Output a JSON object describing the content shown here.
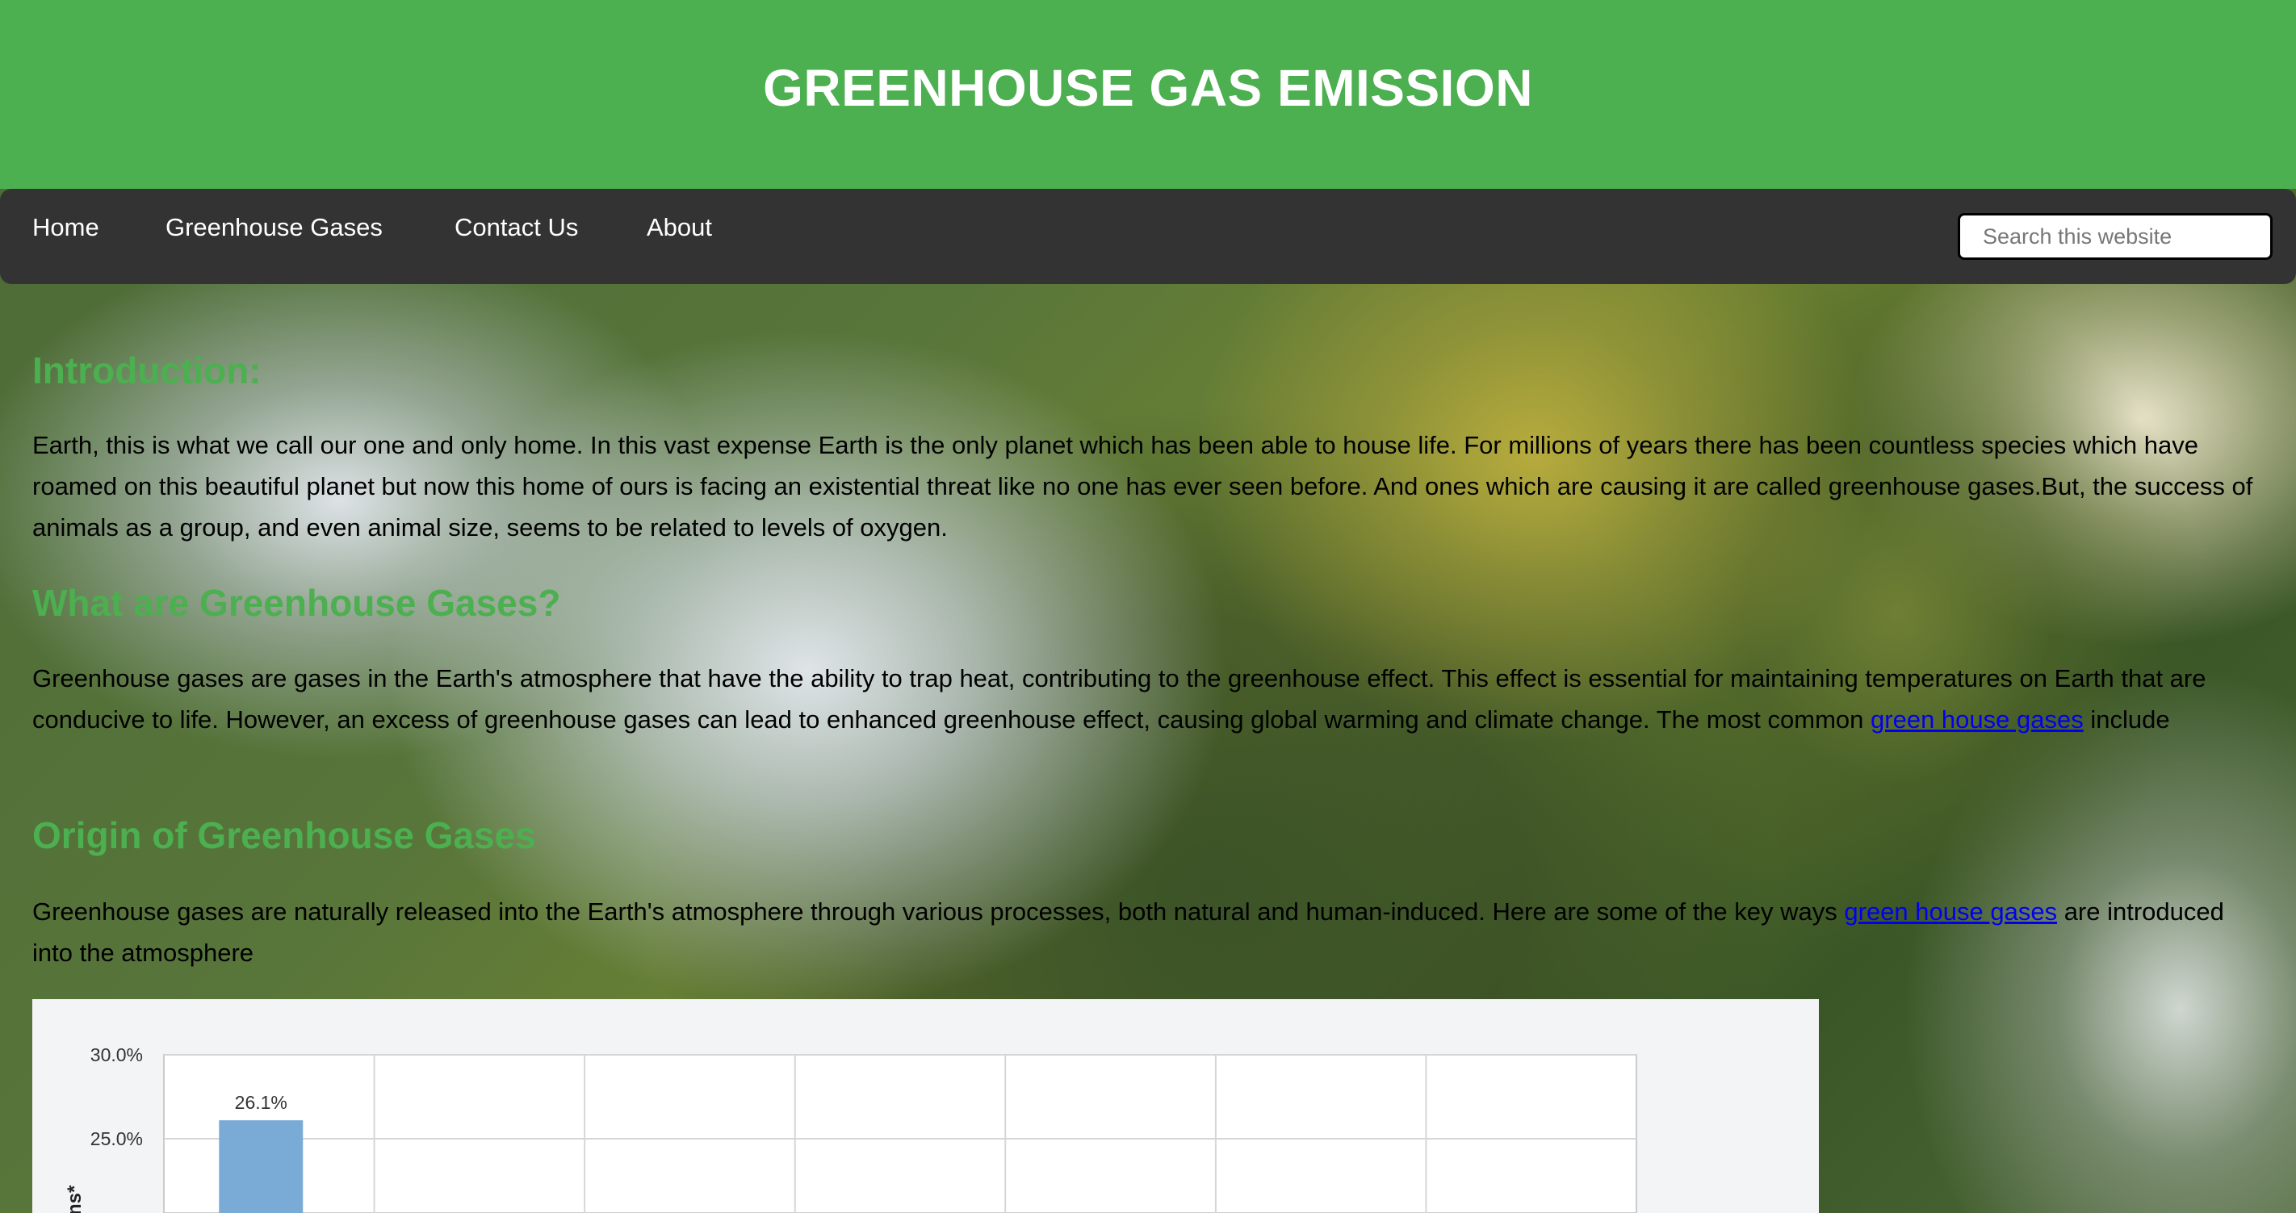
{
  "header": {
    "title": "GREENHOUSE GAS EMISSION"
  },
  "nav": {
    "items": [
      {
        "label": "Home"
      },
      {
        "label": "Greenhouse Gases"
      },
      {
        "label": "Contact Us"
      },
      {
        "label": "About"
      }
    ],
    "search_placeholder": "Search this website"
  },
  "sections": [
    {
      "title": "Introduction:",
      "text": "Earth, this is what we call our one and only home. In this vast expense Earth is the only planet which has been able to house life. For millions of years there has been countless species which have roamed on this beautiful planet but now this home of ours is facing an existential threat like no one has ever seen before. And ones which are causing it are called greenhouse gases.But, the success of animals as a group, and even animal size, seems to be related to levels of oxygen."
    },
    {
      "title": "What are Greenhouse Gases?",
      "text_before": "Greenhouse gases are gases in the Earth's atmosphere that have the ability to trap heat, contributing to the greenhouse effect. This effect is essential for maintaining temperatures on Earth that are conducive to life. However, an excess of greenhouse gases can lead to enhanced greenhouse effect, causing global warming and climate change. The most common ",
      "link": "green house gases",
      "text_after": " include"
    },
    {
      "title": "Origin of Greenhouse Gases",
      "text_before": "Greenhouse gases are naturally released into the Earth's atmosphere through various processes, both natural and human-induced. Here are some of the key ways ",
      "link": "green house gases",
      "text_after": " are introduced into the atmosphere"
    }
  ],
  "chart_data": {
    "type": "bar",
    "yticks": [
      "30.0%",
      "25.0%"
    ],
    "ylim_visible": [
      25.0,
      30.0
    ],
    "bar_color": "#7aabd6",
    "values": [
      26.1
    ],
    "data_labels": [
      "26.1%"
    ],
    "ylabel_fragment": "ns*"
  },
  "colors": {
    "accent": "#4caf50",
    "nav_bg": "#333333",
    "link": "#0000ee"
  }
}
